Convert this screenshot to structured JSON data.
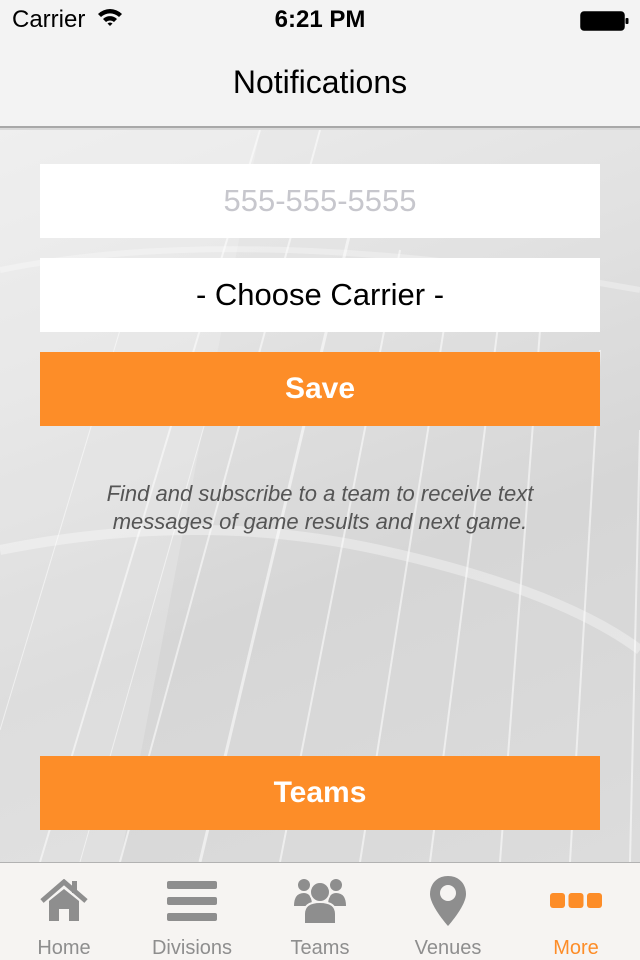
{
  "status_bar": {
    "carrier": "Carrier",
    "time": "6:21 PM",
    "battery_level": 1.0
  },
  "nav": {
    "title": "Notifications"
  },
  "form": {
    "phone_placeholder": "555-555-5555",
    "phone_value": "",
    "carrier_selected": "- Choose Carrier -",
    "save_label": "Save",
    "info_text": "Find and subscribe to a team to receive text messages of game results and next game.",
    "teams_label": "Teams"
  },
  "tab_bar": {
    "active_color": "#fd8d28",
    "inactive_color": "#8e8e8e",
    "items": [
      {
        "label": "Home",
        "icon": "home-icon",
        "active": false
      },
      {
        "label": "Divisions",
        "icon": "list-icon",
        "active": false
      },
      {
        "label": "Teams",
        "icon": "group-icon",
        "active": false
      },
      {
        "label": "Venues",
        "icon": "map-pin-icon",
        "active": false
      },
      {
        "label": "More",
        "icon": "more-icon",
        "active": true
      }
    ]
  },
  "colors": {
    "accent": "#fd8d28",
    "bar_background": "#f3f3f3"
  }
}
